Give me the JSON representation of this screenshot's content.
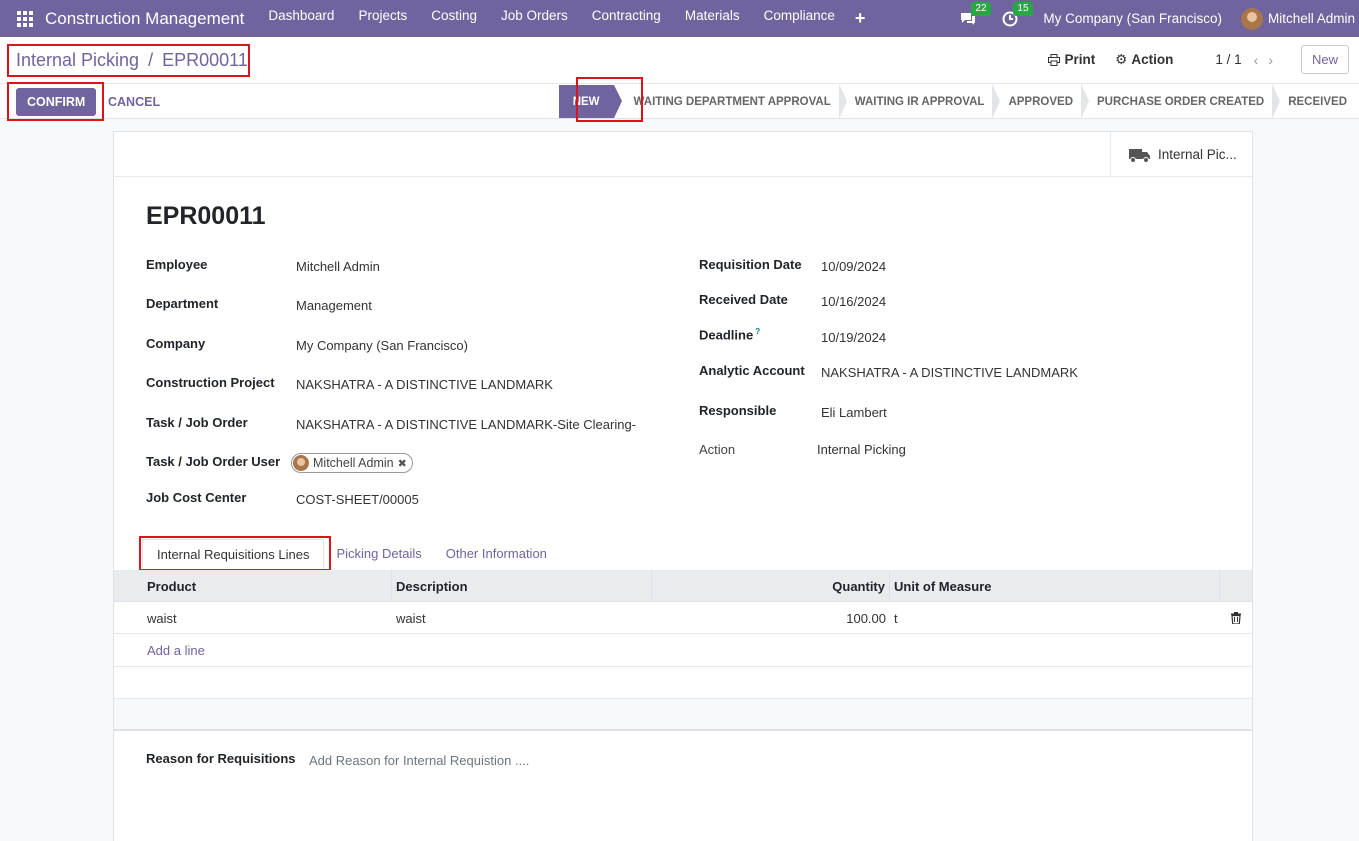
{
  "navbar": {
    "app_name": "Construction Management",
    "menu": [
      "Dashboard",
      "Projects",
      "Costing",
      "Job Orders",
      "Contracting",
      "Materials",
      "Compliance"
    ],
    "plus": "+",
    "messages_count": "22",
    "activities_count": "15",
    "company": "My Company (San Francisco)",
    "user": "Mitchell Admin"
  },
  "breadcrumb": {
    "parent": "Internal Picking",
    "separator": "/",
    "current": "EPR00011"
  },
  "control": {
    "print": "Print",
    "action": "Action",
    "pager": "1 / 1",
    "new_label": "New",
    "confirm": "CONFIRM",
    "cancel": "CANCEL"
  },
  "statusbar": [
    "NEW",
    "WAITING DEPARTMENT APPROVAL",
    "WAITING IR APPROVAL",
    "APPROVED",
    "PURCHASE ORDER CREATED",
    "RECEIVED"
  ],
  "smart_button": "Internal Pic...",
  "record": {
    "name": "EPR00011",
    "left": {
      "employee": {
        "label": "Employee",
        "value": "Mitchell Admin"
      },
      "department": {
        "label": "Department",
        "value": "Management"
      },
      "company": {
        "label": "Company",
        "value": "My Company (San Francisco)"
      },
      "project": {
        "label": "Construction Project",
        "value": "NAKSHATRA - A DISTINCTIVE LANDMARK"
      },
      "task": {
        "label": "Task / Job Order",
        "value": "NAKSHATRA - A DISTINCTIVE LANDMARK-Site Clearing-Ka"
      },
      "task_user": {
        "label": "Task / Job Order User",
        "value": "Mitchell Admin"
      },
      "cost_center": {
        "label": "Job Cost Center",
        "value": "COST-SHEET/00005"
      }
    },
    "right": {
      "req_date": {
        "label": "Requisition Date",
        "value": "10/09/2024"
      },
      "recv_date": {
        "label": "Received Date",
        "value": "10/16/2024"
      },
      "deadline": {
        "label": "Deadline",
        "help": "?",
        "value": "10/19/2024"
      },
      "analytic": {
        "label": "Analytic Account",
        "value": "NAKSHATRA - A DISTINCTIVE LANDMARK"
      },
      "responsible": {
        "label": "Responsible",
        "value": "Eli Lambert"
      },
      "action": {
        "label": "Action",
        "value": "Internal Picking"
      }
    }
  },
  "tabs": [
    "Internal Requisitions Lines",
    "Picking Details",
    "Other Information"
  ],
  "lines": {
    "headers": [
      "Product",
      "Description",
      "Quantity",
      "Unit of Measure"
    ],
    "rows": [
      {
        "product": "waist",
        "description": "waist",
        "quantity": "100.00",
        "uom": "t"
      }
    ],
    "add_line": "Add a line"
  },
  "reason": {
    "label": "Reason for Requisitions",
    "placeholder": "Add Reason for Internal Requistion ...."
  },
  "colors": {
    "brand": "#71639e",
    "highlight": "#d9141a",
    "badge": "#28a745"
  }
}
